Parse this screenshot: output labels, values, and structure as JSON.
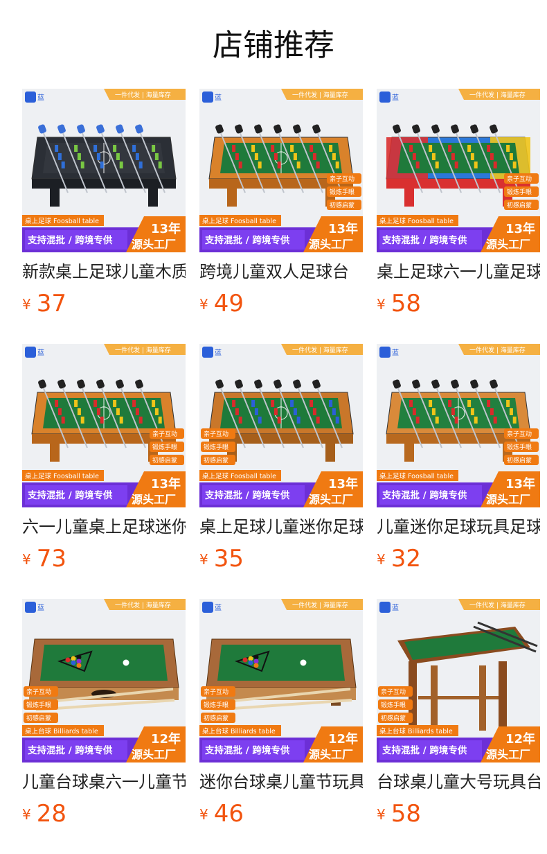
{
  "page": {
    "title": "店铺推荐"
  },
  "theme": {
    "price_color": "#f2540f",
    "banner_purple": "#6c2fd6",
    "badge_orange": "#f07a12",
    "felt_green": "#1f7a3b"
  },
  "overlay": {
    "brand": "蓝",
    "top_ribbon": "一件代发 | 海量库存",
    "bottom_banner": "支持混批 / 跨境专供",
    "factory": "源头工厂",
    "tags": [
      "亲子互动",
      "锻炼手眼",
      "初感启蒙"
    ],
    "foosball_label": "桌上足球 Foosball table",
    "billiards_label": "桌上台球 Billiards table",
    "years_13": "13年",
    "years_12": "12年"
  },
  "products": [
    {
      "name": "新款桌上足球儿童木质",
      "price": "37",
      "kind": "foosball",
      "style": "dark"
    },
    {
      "name": "跨境儿童双人足球台",
      "price": "49",
      "kind": "foosball",
      "style": "wood"
    },
    {
      "name": "桌上足球六一儿童足球",
      "price": "58",
      "kind": "foosball",
      "style": "color"
    },
    {
      "name": "六一儿童桌上足球迷你",
      "price": "73",
      "kind": "foosball",
      "style": "wood"
    },
    {
      "name": "桌上足球儿童迷你足球",
      "price": "35",
      "kind": "foosball",
      "style": "wood2"
    },
    {
      "name": "儿童迷你足球玩具足球",
      "price": "32",
      "kind": "foosball",
      "style": "wood3"
    },
    {
      "name": "儿童台球桌六一儿童节",
      "price": "28",
      "kind": "billiards",
      "style": "short"
    },
    {
      "name": "迷你台球桌儿童节玩具",
      "price": "46",
      "kind": "billiards",
      "style": "legs"
    },
    {
      "name": "台球桌儿童大号玩具台",
      "price": "58",
      "kind": "billiards",
      "style": "tall"
    }
  ]
}
